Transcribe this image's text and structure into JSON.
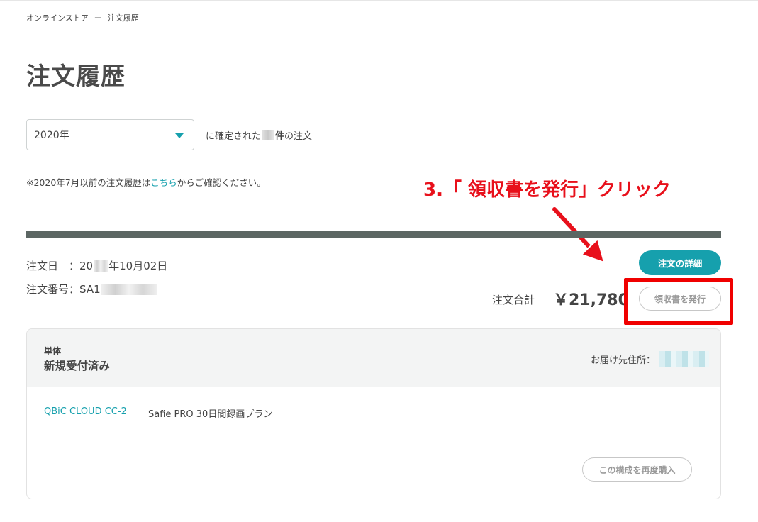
{
  "breadcrumb": {
    "store": "オンラインストア",
    "separator": "ー",
    "current": "注文履歴"
  },
  "page": {
    "title": "注文履歴"
  },
  "filter": {
    "year_value": "2020年",
    "count_prefix": "に確定された",
    "count_suffix": "件",
    "count_tail": "の注文"
  },
  "notice": {
    "prefix": "※2020年7月以前の注文履歴は",
    "link": "こちら",
    "suffix": "からご確認ください。"
  },
  "annotation": {
    "text": "3.「 領収書を発行」クリック",
    "color": "#e8101b"
  },
  "order": {
    "date_label": "注文日　：",
    "date_year_prefix": "20",
    "date_rest": "年10月02日",
    "number_label": "注文番号：",
    "number_prefix": "SA1",
    "detail_button": "注文の詳細",
    "total_label": "注文合計",
    "total_value": "￥21,780",
    "receipt_button": "領収書を発行"
  },
  "shipment": {
    "type": "単体",
    "status": "新規受付済み",
    "delivery_label": "お届け先住所：",
    "product": "QBiC CLOUD CC-2",
    "plan": "Safie PRO 30日間録画プラン",
    "rebuy_button": "この構成を再度購入"
  },
  "colors": {
    "accent": "#16a0ad",
    "bar": "#5c6663",
    "highlight": "#f00000"
  }
}
